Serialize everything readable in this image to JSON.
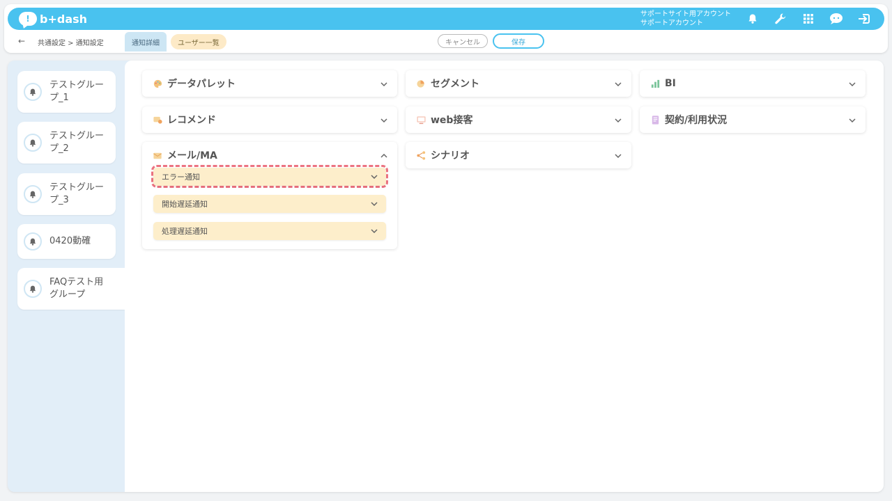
{
  "header": {
    "logo_text": "b+dash",
    "account_line1": "サポートサイト用アカウント",
    "account_line2": "サポートアカウント",
    "back_arrow": "←",
    "breadcrumb": "共通設定 > 通知設定",
    "tabs": [
      {
        "label": "通知詳細"
      },
      {
        "label": "ユーザー一覧"
      }
    ],
    "cancel_label": "キャンセル",
    "save_label": "保存"
  },
  "sidebar": {
    "items": [
      {
        "label": "テストグルー\nプ_1"
      },
      {
        "label": "テストグルー\nプ_2"
      },
      {
        "label": "テストグルー\nプ_3"
      },
      {
        "label": "0420動確"
      },
      {
        "label": "FAQテスト用\nグループ"
      }
    ]
  },
  "categories": {
    "data_palette": "データパレット",
    "segment": "セグメント",
    "bi": "BI",
    "recommend": "レコメンド",
    "web_service": "web接客",
    "contract": "契約/利用状況",
    "mail_ma": "メール/MA",
    "scenario": "シナリオ"
  },
  "mail_ma_items": [
    {
      "label": "エラー通知"
    },
    {
      "label": "開始遅延通知"
    },
    {
      "label": "処理遅延通知"
    }
  ],
  "colors": {
    "topbar": "#49c2ef",
    "highlight_dash": "#ec7381",
    "sub_item_bg": "#fdeecb"
  }
}
